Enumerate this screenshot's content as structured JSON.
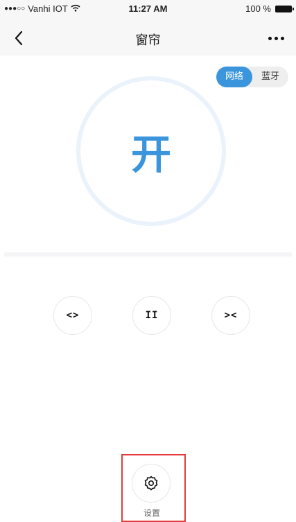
{
  "status_bar": {
    "signal": "●●●○○",
    "carrier": "Vanhi IOT",
    "wifi_icon": "wifi-icon",
    "time": "11:27 AM",
    "battery_text": "100 %",
    "battery_icon": "battery-icon"
  },
  "nav": {
    "back_icon": "chevron-left-icon",
    "title": "窗帘",
    "more_icon": "more-dots-icon"
  },
  "connection_toggle": {
    "options": [
      "网络",
      "蓝牙"
    ],
    "selected": "网络"
  },
  "power": {
    "state_label": "开"
  },
  "controls": {
    "open_icon": "<>",
    "pause_icon": "II",
    "close_icon": "><"
  },
  "settings": {
    "icon": "gear-icon",
    "label": "设置"
  },
  "colors": {
    "accent": "#3a95dd",
    "ring": "#eaf2fb",
    "highlight_box": "#e23b3b"
  }
}
